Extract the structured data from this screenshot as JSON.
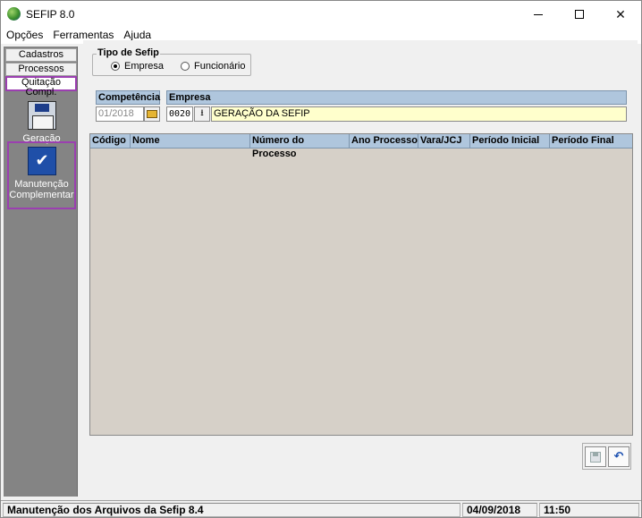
{
  "window": {
    "title": "SEFIP 8.0",
    "controls": {
      "minimize": "minimize-icon",
      "maximize": "maximize-icon",
      "close": "✕"
    }
  },
  "menu": [
    "Opções",
    "Ferramentas",
    "Ajuda"
  ],
  "sidebar": {
    "tabs": [
      "Cadastros",
      "Processos",
      "Quitação Compl."
    ],
    "active_tab": "Quitação Compl.",
    "actions": [
      {
        "label": "Geração",
        "icon": "disk-icon"
      },
      {
        "label_line1": "Manutenção",
        "label_line2": "Complementar",
        "icon": "checklist-icon"
      }
    ]
  },
  "tipo_sefip": {
    "legend": "Tipo de Sefip",
    "options": [
      "Empresa",
      "Funcionário"
    ],
    "selected": "Empresa"
  },
  "competencia": {
    "label": "Competência",
    "value": "01/2018"
  },
  "empresa": {
    "label": "Empresa",
    "code": "0020",
    "name": "GERAÇÃO DA SEFIP"
  },
  "grid": {
    "columns": [
      "Código",
      "Nome",
      "Número do Processo",
      "Ano Processo",
      "Vara/JCJ",
      "Período Inicial",
      "Período Final"
    ],
    "rows": []
  },
  "toolbar": {
    "save_icon": "save-icon",
    "undo_icon": "undo-icon",
    "undo_glyph": "↶"
  },
  "status": {
    "message": "Manutenção dos Arquivos da Sefip 8.4",
    "date": "04/09/2018",
    "time": "11:50"
  },
  "colors": {
    "sidebar_bg": "#848484",
    "header_bg": "#afc6dd",
    "grid_bg": "#d6d0c8",
    "highlight": "#9b3fb0",
    "empresa_field": "#ffffcc"
  }
}
